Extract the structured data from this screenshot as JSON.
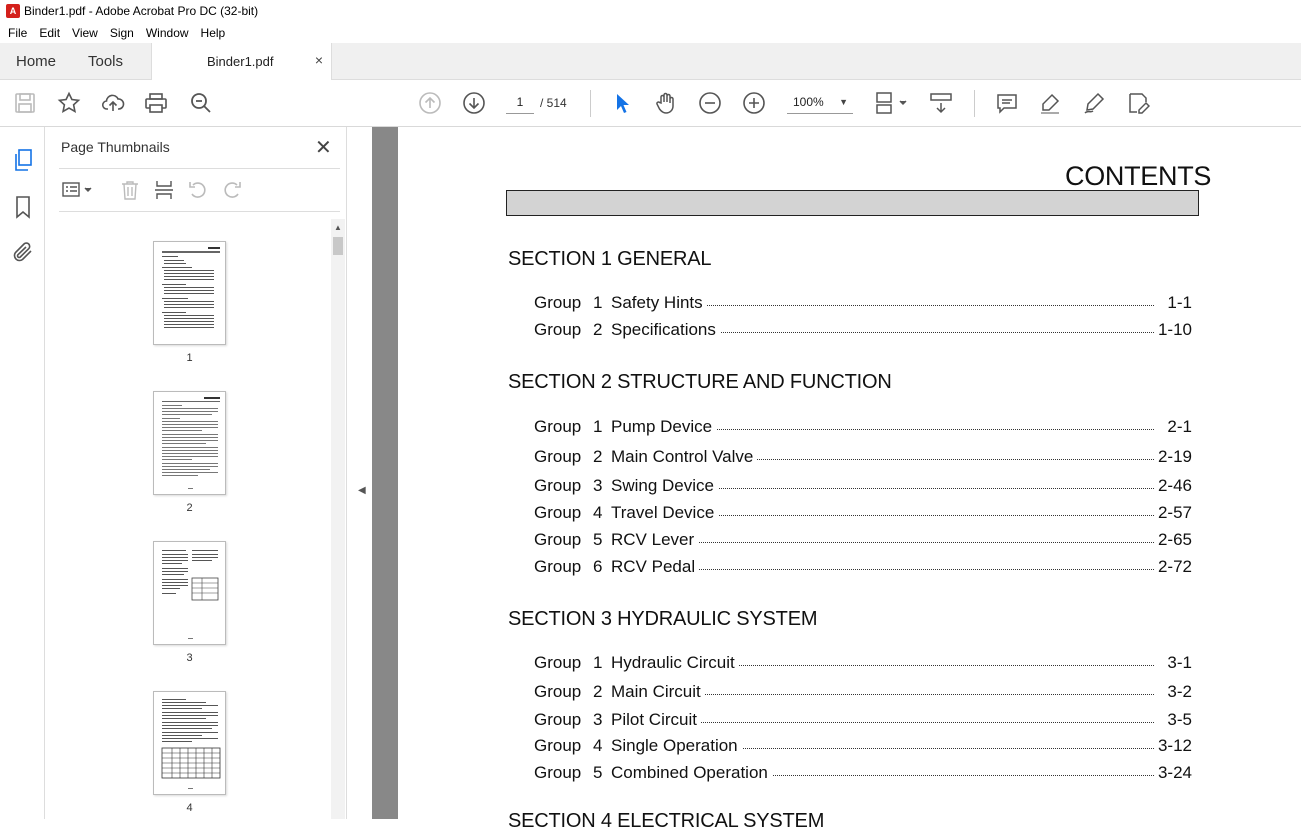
{
  "window": {
    "title": "Binder1.pdf - Adobe Acrobat Pro DC (32-bit)"
  },
  "menu": [
    "File",
    "Edit",
    "View",
    "Sign",
    "Window",
    "Help"
  ],
  "tabs": {
    "home": "Home",
    "tools": "Tools",
    "document": "Binder1.pdf",
    "close": "×"
  },
  "toolbar": {
    "page_current": "1",
    "page_total": "/ 514",
    "zoom": "100%"
  },
  "thumbnails": {
    "title": "Page Thumbnails",
    "pages": [
      "1",
      "2",
      "3",
      "4"
    ]
  },
  "document": {
    "heading": "CONTENTS",
    "sections": [
      {
        "title": "SECTION 1  GENERAL",
        "groups": [
          {
            "label": "Group",
            "num": "1",
            "name": "Safety Hints",
            "page": "1-1"
          },
          {
            "label": "Group",
            "num": "2",
            "name": "Specifications",
            "page": "1-10"
          }
        ]
      },
      {
        "title": "SECTION 2  STRUCTURE AND FUNCTION",
        "groups": [
          {
            "label": "Group",
            "num": "1",
            "name": "Pump Device",
            "page": "2-1"
          },
          {
            "label": "Group",
            "num": "2",
            "name": "Main Control Valve",
            "page": "2-19"
          },
          {
            "label": "Group",
            "num": "3",
            "name": "Swing Device",
            "page": "2-46"
          },
          {
            "label": "Group",
            "num": "4",
            "name": "Travel Device",
            "page": "2-57"
          },
          {
            "label": "Group",
            "num": "5",
            "name": "RCV Lever",
            "page": "2-65"
          },
          {
            "label": "Group",
            "num": "6",
            "name": "RCV Pedal",
            "page": "2-72"
          }
        ]
      },
      {
        "title": "SECTION 3  HYDRAULIC SYSTEM",
        "groups": [
          {
            "label": "Group",
            "num": "1",
            "name": "Hydraulic Circuit",
            "page": "3-1"
          },
          {
            "label": "Group",
            "num": "2",
            "name": "Main Circuit",
            "page": "3-2"
          },
          {
            "label": "Group",
            "num": "3",
            "name": "Pilot Circuit",
            "page": "3-5"
          },
          {
            "label": "Group",
            "num": "4",
            "name": "Single Operation",
            "page": "3-12"
          },
          {
            "label": "Group",
            "num": "5",
            "name": "Combined Operation",
            "page": "3-24"
          }
        ]
      },
      {
        "title": "SECTION 4  ELECTRICAL SYSTEM",
        "groups": []
      }
    ]
  },
  "colors": {
    "accent": "#1473e6",
    "acrobat_red": "#d4201b",
    "doc_background": "#888888"
  }
}
